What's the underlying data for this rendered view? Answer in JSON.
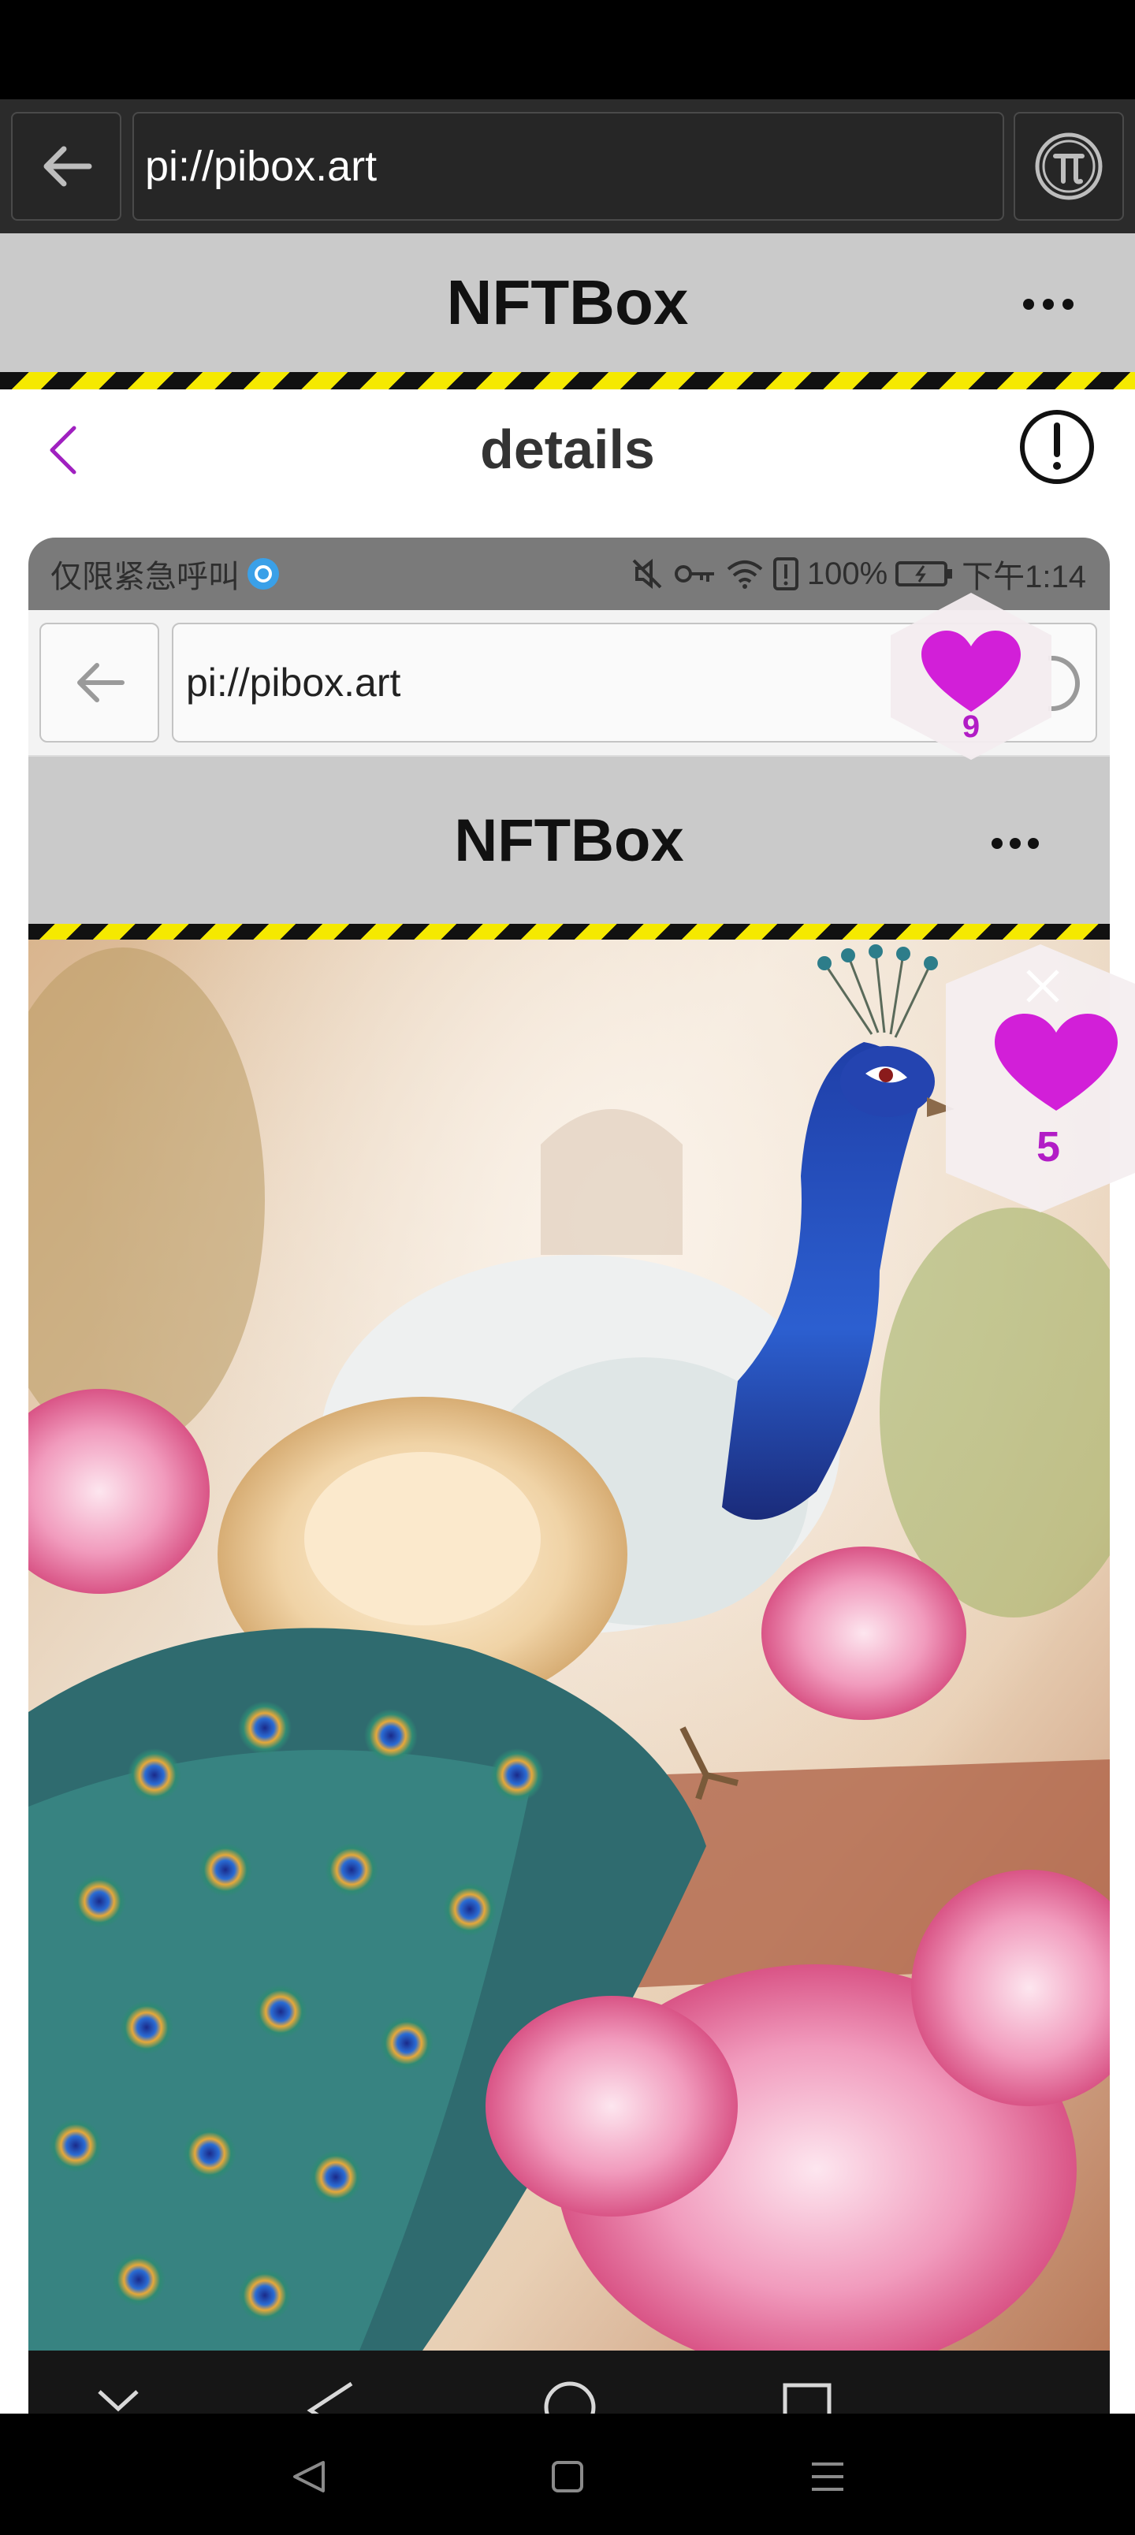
{
  "browser": {
    "url": "pi://pibox.art",
    "back_icon": "arrow-left-icon",
    "pi_icon": "pi-logo-icon"
  },
  "app": {
    "title": "NFTBox",
    "menu_icon": "more-horizontal-icon"
  },
  "details": {
    "title": "details",
    "back_icon": "chevron-left-icon",
    "info_icon": "exclamation-circle-icon"
  },
  "inner_screenshot": {
    "status_left": "仅限紧急呼叫",
    "battery": "100%",
    "time": "下午1:14",
    "url": "pi://pibox.art",
    "app_title": "NFTBox"
  },
  "likes": {
    "primary_count": "9",
    "secondary_count": "5",
    "heart_color": "#d21fd8"
  },
  "colors": {
    "accent": "#b21cc6",
    "header_gray": "#cacaca",
    "hazard_yellow": "#f5e900"
  }
}
